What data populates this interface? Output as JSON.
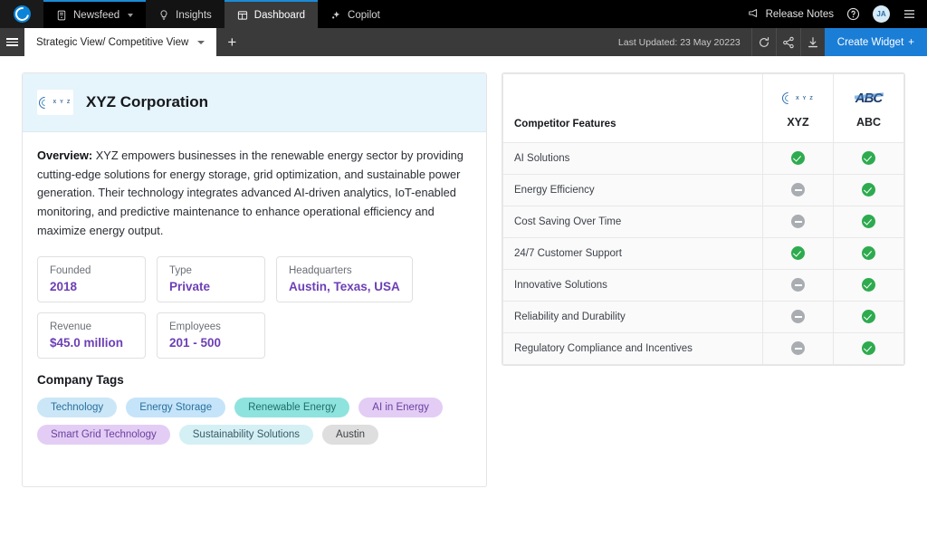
{
  "topnav": {
    "brand_icon": "circular-c-logo",
    "items": [
      {
        "label": "Newsfeed",
        "icon": "newsfeed-icon",
        "has_chevron": true,
        "state": "accent"
      },
      {
        "label": "Insights",
        "icon": "lightbulb-icon",
        "has_chevron": false,
        "state": "dim"
      },
      {
        "label": "Dashboard",
        "icon": "dashboard-icon",
        "has_chevron": false,
        "state": "active"
      },
      {
        "label": "Copilot",
        "icon": "sparkle-icon",
        "has_chevron": false,
        "state": "plain"
      }
    ],
    "release_notes": "Release Notes",
    "release_notes_icon": "megaphone-icon",
    "help_icon": "question-circle-icon",
    "avatar_initials": "JA",
    "menu_icon": "hamburger-icon"
  },
  "tabbar": {
    "menu_icon": "hamburger-icon",
    "active_tab": "Strategic View/ Competitive View",
    "tab_chevron_icon": "chevron-down-icon",
    "add_tab_label": "+",
    "last_updated": "Last Updated: 23 May 20223",
    "tools": [
      {
        "name": "refresh-icon"
      },
      {
        "name": "share-icon"
      },
      {
        "name": "download-icon"
      }
    ],
    "create_widget": "Create Widget",
    "create_widget_plus": "+"
  },
  "company": {
    "name": "XYZ Corporation",
    "logo_letters": "X Y Z",
    "overview_label": "Overview:",
    "overview_text": " XYZ empowers businesses in the renewable energy sector by providing cutting-edge solutions for energy storage, grid optimization, and sustainable power generation. Their technology integrates advanced AI-driven analytics, IoT-enabled monitoring, and predictive maintenance to enhance operational efficiency and maximize energy output.",
    "facts_row1": [
      {
        "label": "Founded",
        "value": "2018"
      },
      {
        "label": "Type",
        "value": "Private"
      },
      {
        "label": "Headquarters",
        "value": "Austin, Texas, USA"
      }
    ],
    "facts_row2": [
      {
        "label": "Revenue",
        "value": "$45.0 million"
      },
      {
        "label": "Employees",
        "value": "201 - 500"
      }
    ],
    "tags_title": "Company Tags",
    "tags": [
      {
        "label": "Technology",
        "bg": "#cbe7f7",
        "fg": "#2a6f9e"
      },
      {
        "label": "Energy Storage",
        "bg": "#c5e4f9",
        "fg": "#2a6f9e"
      },
      {
        "label": "Renewable Energy",
        "bg": "#8fe3de",
        "fg": "#1f6f6a"
      },
      {
        "label": "AI in Energy",
        "bg": "#e3cdf5",
        "fg": "#6a3fa0"
      },
      {
        "label": "Smart Grid Technology",
        "bg": "#e3cdf5",
        "fg": "#6a3fa0"
      },
      {
        "label": "Sustainability Solutions",
        "bg": "#d4f0f5",
        "fg": "#3a5a66"
      },
      {
        "label": "Austin",
        "bg": "#dedede",
        "fg": "#3d4045"
      }
    ]
  },
  "comparison": {
    "feature_header": "Competitor Features",
    "columns": [
      {
        "name": "XYZ",
        "logo": "xyz-swoosh-logo",
        "logo_letters": "X Y Z"
      },
      {
        "name": "ABC",
        "logo": "abc-monogram-logo",
        "logo_text": "ABC"
      }
    ],
    "rows": [
      {
        "feature": "AI Solutions",
        "values": [
          "yes",
          "yes"
        ]
      },
      {
        "feature": "Energy Efficiency",
        "values": [
          "no",
          "yes"
        ]
      },
      {
        "feature": "Cost Saving Over Time",
        "values": [
          "no",
          "yes"
        ]
      },
      {
        "feature": "24/7 Customer Support",
        "values": [
          "yes",
          "yes"
        ]
      },
      {
        "feature": "Innovative Solutions",
        "values": [
          "no",
          "yes"
        ]
      },
      {
        "feature": "Reliability and Durability",
        "values": [
          "no",
          "yes"
        ]
      },
      {
        "feature": "Regulatory Compliance and Incentives",
        "values": [
          "no",
          "yes"
        ]
      }
    ],
    "colors": {
      "yes": "#2eab4f",
      "no": "#a9adb2"
    }
  }
}
